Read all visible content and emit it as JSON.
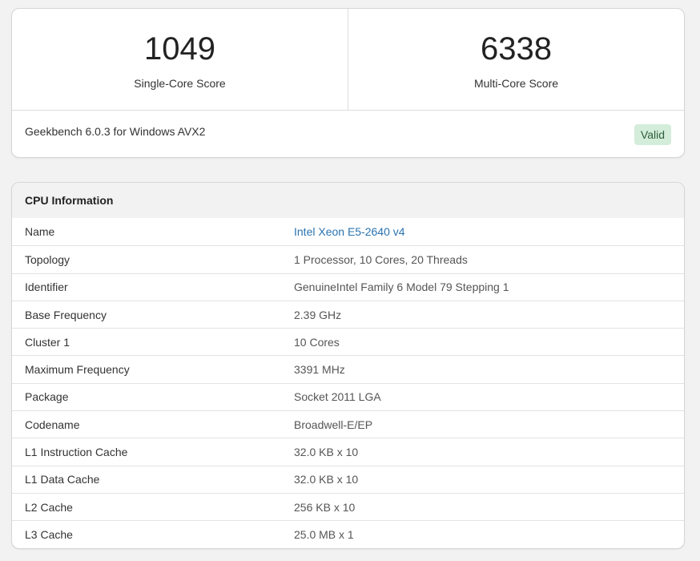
{
  "scores": {
    "single": {
      "value": "1049",
      "label": "Single-Core Score"
    },
    "multi": {
      "value": "6338",
      "label": "Multi-Core Score"
    }
  },
  "version": "Geekbench 6.0.3 for Windows AVX2",
  "validity": "Valid",
  "cpu": {
    "title": "CPU Information",
    "rows": [
      {
        "k": "Name",
        "v": "Intel Xeon E5-2640 v4"
      },
      {
        "k": "Topology",
        "v": "1 Processor, 10 Cores, 20 Threads"
      },
      {
        "k": "Identifier",
        "v": "GenuineIntel Family 6 Model 79 Stepping 1"
      },
      {
        "k": "Base Frequency",
        "v": "2.39 GHz"
      },
      {
        "k": "Cluster 1",
        "v": "10 Cores"
      },
      {
        "k": "Maximum Frequency",
        "v": "3391 MHz"
      },
      {
        "k": "Package",
        "v": "Socket 2011 LGA"
      },
      {
        "k": "Codename",
        "v": "Broadwell-E/EP"
      },
      {
        "k": "L1 Instruction Cache",
        "v": "32.0 KB x 10"
      },
      {
        "k": "L1 Data Cache",
        "v": "32.0 KB x 10"
      },
      {
        "k": "L2 Cache",
        "v": "256 KB x 10"
      },
      {
        "k": "L3 Cache",
        "v": "25.0 MB x 1"
      }
    ]
  }
}
